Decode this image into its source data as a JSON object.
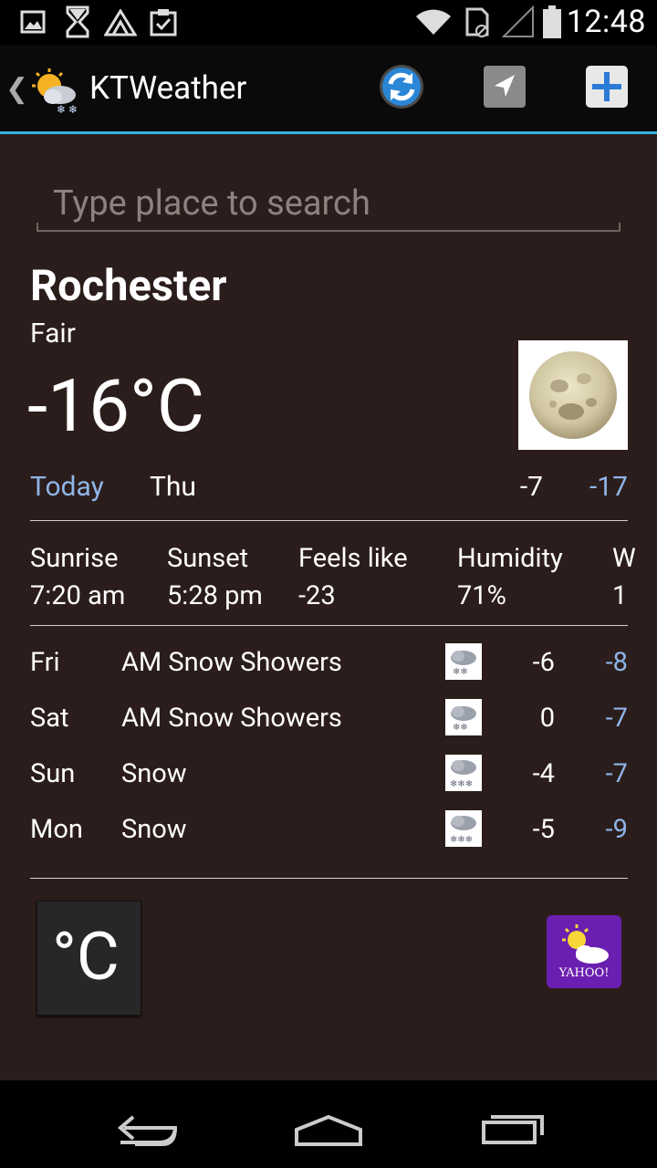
{
  "status": {
    "time": "12:48",
    "icons": [
      "gallery-icon",
      "hourglass-icon",
      "mountain-icon",
      "clipboard-check-icon",
      "wifi-icon",
      "sim-card-icon",
      "signal-icon",
      "battery-icon"
    ]
  },
  "actionbar": {
    "title": "KTWeather",
    "back_glyph": "❮",
    "app_icon": "sun-cloud-snow-icon",
    "buttons": [
      "refresh-icon",
      "location-arrow-icon",
      "add-icon"
    ],
    "accent": "#33b5e5"
  },
  "search": {
    "placeholder": "Type place to search",
    "value": ""
  },
  "current": {
    "city": "Rochester",
    "condition": "Fair",
    "temperature": "-16°C",
    "icon": "moon-icon"
  },
  "today": {
    "label": "Today",
    "day": "Thu",
    "high": "-7",
    "low": "-17"
  },
  "stats": [
    {
      "label": "Sunrise",
      "value": "7:20 am"
    },
    {
      "label": "Sunset",
      "value": "5:28 pm"
    },
    {
      "label": "Feels like",
      "value": "-23"
    },
    {
      "label": "Humidity",
      "value": "71%"
    },
    {
      "label": "W",
      "value": "1"
    }
  ],
  "forecast": [
    {
      "day": "Fri",
      "desc": "AM Snow Showers",
      "icon": "snow-cloud-icon",
      "high": "-6",
      "low": "-8"
    },
    {
      "day": "Sat",
      "desc": "AM Snow Showers",
      "icon": "snow-cloud-icon",
      "high": "0",
      "low": "-7"
    },
    {
      "day": "Sun",
      "desc": "Snow",
      "icon": "snow-cloud-icon",
      "high": "-4",
      "low": "-7"
    },
    {
      "day": "Mon",
      "desc": "Snow",
      "icon": "snow-cloud-icon",
      "high": "-5",
      "low": "-9"
    }
  ],
  "footer": {
    "unit_label": "°C",
    "yahoo_label": "YAHOO!"
  },
  "navbar": {
    "buttons": [
      "back-icon",
      "home-icon",
      "recent-apps-icon"
    ]
  },
  "colors": {
    "background": "#2b1d1b",
    "low_temp": "#8fb5e8",
    "yahoo_purple": "#6a1fb0"
  }
}
